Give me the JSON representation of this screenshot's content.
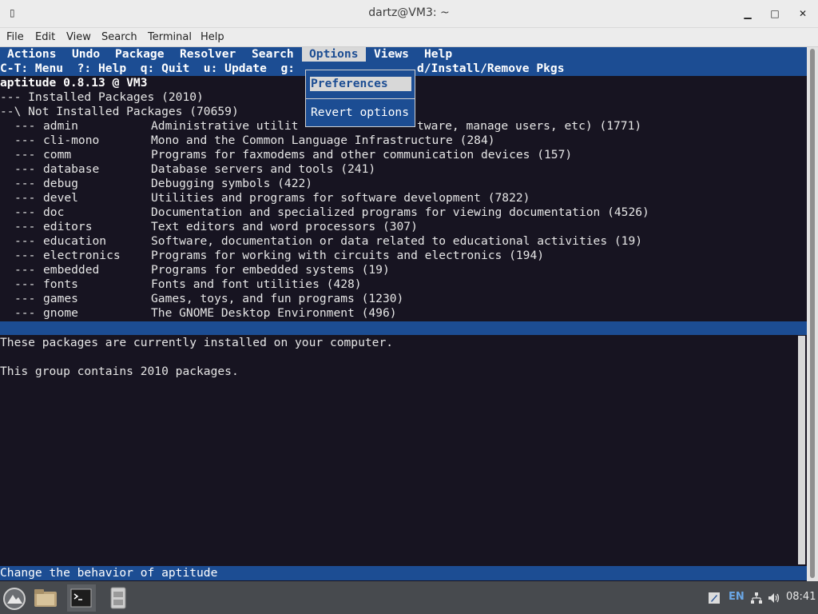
{
  "window": {
    "title": "dartz@VM3: ~",
    "minimize_symbol": "▁",
    "maximize_symbol": "□",
    "close_symbol": "✕",
    "app_icon_symbol": "▯"
  },
  "appmenu": [
    "File",
    "Edit",
    "View",
    "Search",
    "Terminal",
    "Help"
  ],
  "aptitude": {
    "menubar": [
      "Actions",
      "Undo",
      "Package",
      "Resolver",
      "Search",
      "Options",
      "Views",
      "Help"
    ],
    "open_menu": "Options",
    "hints_left": "C-T: Menu  ?: Help  q: Quit  u: Update  g:",
    "hints_right": "d/Install/Remove Pkgs",
    "version_line": "aptitude 0.8.13 @ VM3",
    "groups": [
      "--- Installed Packages (2010)",
      "--\\ Not Installed Packages (70659)"
    ],
    "sections": [
      {
        "name": "admin",
        "desc": "Administrative utilit"
      },
      {
        "name": "cli-mono",
        "desc": "Mono and the Common Language Infrastructure (284)"
      },
      {
        "name": "comm",
        "desc": "Programs for faxmodems and other communication devices (157)"
      },
      {
        "name": "database",
        "desc": "Database servers and tools (241)"
      },
      {
        "name": "debug",
        "desc": "Debugging symbols (422)"
      },
      {
        "name": "devel",
        "desc": "Utilities and programs for software development (7822)"
      },
      {
        "name": "doc",
        "desc": "Documentation and specialized programs for viewing documentation (4526)"
      },
      {
        "name": "editors",
        "desc": "Text editors and word processors (307)"
      },
      {
        "name": "education",
        "desc": "Software, documentation or data related to educational activities (19)"
      },
      {
        "name": "electronics",
        "desc": "Programs for working with circuits and electronics (194)"
      },
      {
        "name": "embedded",
        "desc": "Programs for embedded systems (19)"
      },
      {
        "name": "fonts",
        "desc": "Fonts and font utilities (428)"
      },
      {
        "name": "games",
        "desc": "Games, toys, and fun programs (1230)"
      },
      {
        "name": "gnome",
        "desc": "The GNOME Desktop Environment (496)"
      }
    ],
    "admin_desc_tail": "tware, manage users, etc) (1771)",
    "info_line1": "These packages are currently installed on your computer.",
    "info_line2": "This group contains 2010 packages.",
    "status_line": "Change the behavior of aptitude",
    "options_menu": {
      "items": [
        {
          "label": "Preferences",
          "hotkey": "P",
          "selected": true
        },
        {
          "label": "Revert options",
          "hotkey": "R",
          "selected": false
        }
      ]
    }
  },
  "taskbar": {
    "time": "08:41",
    "lang": "EN"
  },
  "colors": {
    "terminal_bg": "#171421",
    "aptitude_blue": "#1c4d93",
    "highlight": "#d8d8d8"
  }
}
